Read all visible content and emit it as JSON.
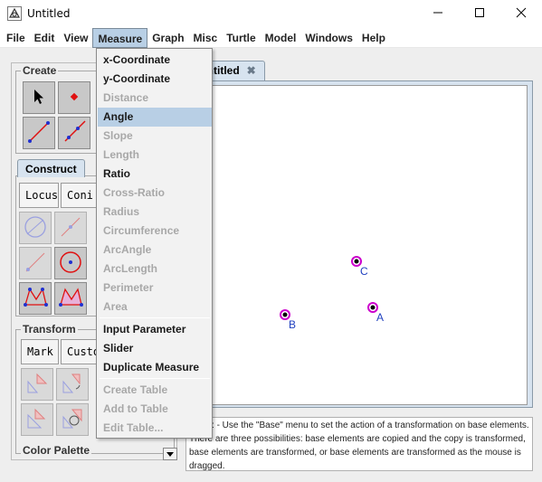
{
  "window": {
    "title": "Untitled"
  },
  "menubar": {
    "items": [
      "File",
      "Edit",
      "View",
      "Measure",
      "Graph",
      "Misc",
      "Turtle",
      "Model",
      "Windows",
      "Help"
    ],
    "active": "Measure"
  },
  "measure_menu": {
    "items": [
      {
        "label": "x-Coordinate",
        "enabled": true
      },
      {
        "label": "y-Coordinate",
        "enabled": true
      },
      {
        "label": "Distance",
        "enabled": false
      },
      {
        "label": "Angle",
        "enabled": true,
        "selected": true
      },
      {
        "label": "Slope",
        "enabled": false
      },
      {
        "label": "Length",
        "enabled": false
      },
      {
        "label": "Ratio",
        "enabled": true
      },
      {
        "label": "Cross-Ratio",
        "enabled": false
      },
      {
        "label": "Radius",
        "enabled": false
      },
      {
        "label": "Circumference",
        "enabled": false
      },
      {
        "label": "ArcAngle",
        "enabled": false
      },
      {
        "label": "ArcLength",
        "enabled": false
      },
      {
        "label": "Perimeter",
        "enabled": false
      },
      {
        "label": "Area",
        "enabled": false
      },
      {
        "label": "Input Parameter",
        "enabled": true
      },
      {
        "label": "Slider",
        "enabled": true
      },
      {
        "label": "Duplicate Measure",
        "enabled": true
      },
      {
        "label": "Create Table",
        "enabled": false
      },
      {
        "label": "Add to Table",
        "enabled": false
      },
      {
        "label": "Edit Table...",
        "enabled": false
      }
    ]
  },
  "left_panel": {
    "create_title": "Create",
    "construct_tab": "Construct",
    "locus_button": "Locus",
    "conic_button": "Coni",
    "transform_title": "Transform",
    "mark_button": "Mark",
    "custom_button": "Custo",
    "color_palette_title": "Color Palette"
  },
  "document": {
    "tab_label": "Untitled",
    "tab_close": "✖",
    "points": [
      {
        "label": "A"
      },
      {
        "label": "B"
      },
      {
        "label": "C"
      }
    ]
  },
  "help_text": "Menu: - Use the \"Base\" menu to set the action of a transformation on base elements. There are three possibilities: base elements are copied and the copy is transformed, base elements are transformed, or base elements are transformed as the mouse is dragged.",
  "colors": {
    "accent": "#b8cfe5",
    "point_ring": "#cc00cc",
    "label": "#1f3fbf"
  }
}
